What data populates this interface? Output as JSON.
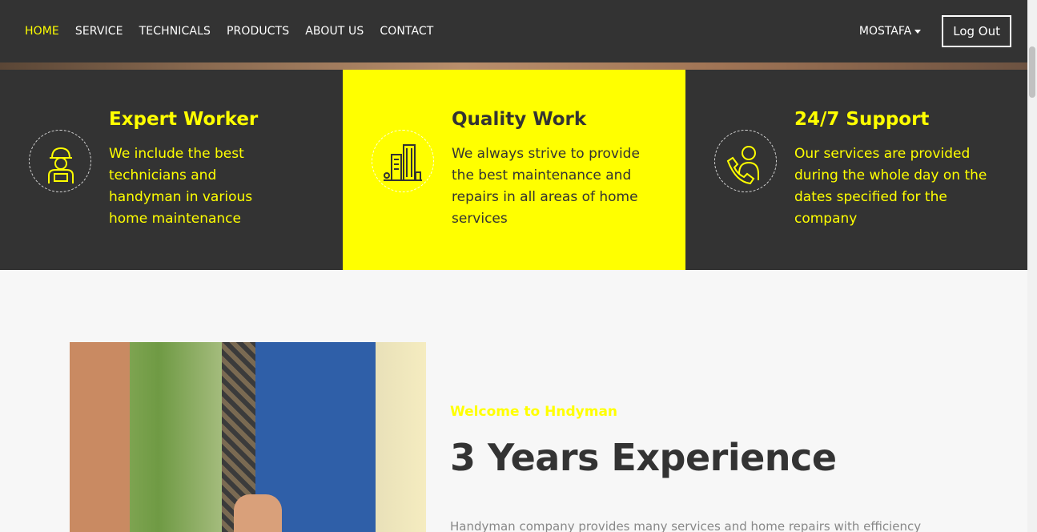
{
  "nav": {
    "links": [
      "HOME",
      "SERVICE",
      "TECHNICALS",
      "PRODUCTS",
      "ABOUT US",
      "CONTACT"
    ],
    "active": "HOME",
    "user": "MOSTAFA",
    "logout_label": "Log Out"
  },
  "features": [
    {
      "title": "Expert Worker",
      "text": "We include the best technicians and handyman in various home maintenance",
      "icon": "worker-icon"
    },
    {
      "title": "Quality Work",
      "text": "We always strive to provide the best maintenance and repairs in all areas of home services",
      "icon": "buildings-icon"
    },
    {
      "title": "24/7 Support",
      "text": "Our services are provided during the whole day on the dates specified for the company",
      "icon": "support-phone-icon"
    }
  ],
  "about": {
    "welcome": "Welcome to Hndyman",
    "title": "3 Years Experience",
    "text": "Handyman company provides many services and home repairs with efficiency"
  },
  "colors": {
    "accent": "#ffff00",
    "dark": "#333333",
    "background": "#f7f7f7"
  }
}
